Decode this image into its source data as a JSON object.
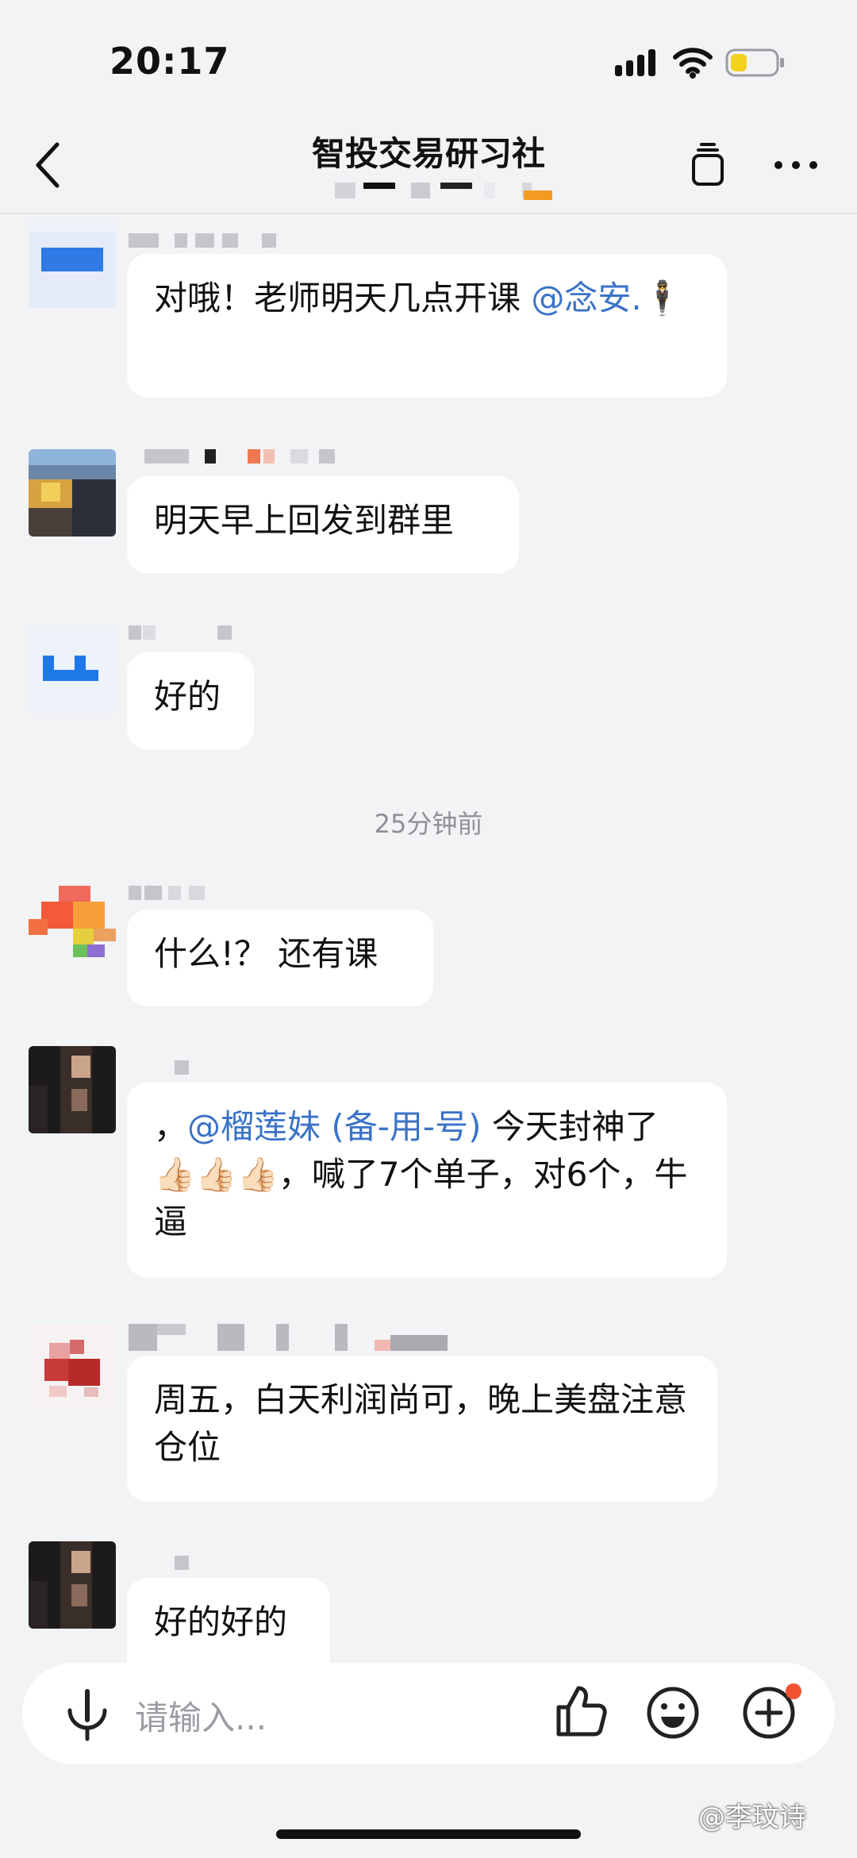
{
  "status": {
    "time": "20:17"
  },
  "header": {
    "title": "智投交易研习社"
  },
  "messages": [
    {
      "text_before": "对哦！老师明天几点开课 ",
      "mention": "@念安.",
      "text_after": "🕴"
    },
    {
      "text": "明天早上回发到群里"
    },
    {
      "text": "好的"
    },
    {
      "text": "什么!？ 还有课"
    },
    {
      "text_before": "，",
      "mention": "@榴莲妹 (备-用-号)",
      "text_after": " 今天封神了👍🏻👍🏻👍🏻，喊了7个单子，对6个，牛逼"
    },
    {
      "text": "周五，白天利润尚可，晚上美盘注意仓位"
    },
    {
      "text": "好的好的"
    }
  ],
  "timestamp": "25分钟前",
  "input": {
    "placeholder": "请输入..."
  },
  "watermark": "@李玟诗",
  "icons": {
    "back": "chevron-left-icon",
    "copy": "copy-icon",
    "more": "more-dots-icon",
    "mic": "microphone-icon",
    "like": "thumbs-up-icon",
    "emoji": "smiley-icon",
    "add": "plus-circle-icon"
  },
  "colors": {
    "mention": "#3a73c8",
    "background": "#f2f3f5",
    "badge": "#f0522f"
  }
}
